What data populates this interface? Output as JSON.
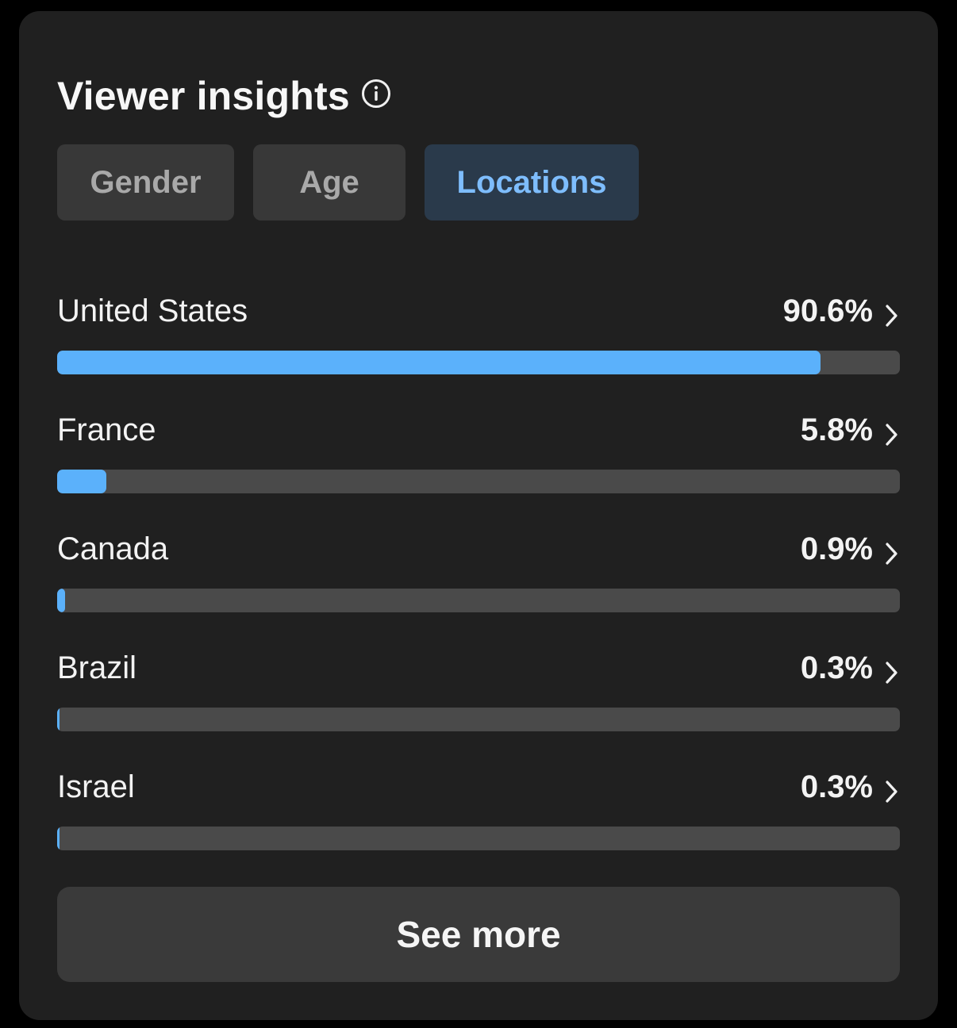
{
  "header": {
    "title": "Viewer insights",
    "info_icon": "info-circle-icon"
  },
  "tabs": [
    {
      "label": "Gender",
      "active": false
    },
    {
      "label": "Age",
      "active": false
    },
    {
      "label": "Locations",
      "active": true
    }
  ],
  "locations": [
    {
      "name": "United States",
      "value": "90.6%",
      "fraction": 0.906
    },
    {
      "name": "France",
      "value": "5.8%",
      "fraction": 0.058
    },
    {
      "name": "Canada",
      "value": "0.9%",
      "fraction": 0.009
    },
    {
      "name": "Brazil",
      "value": "0.3%",
      "fraction": 0.003
    },
    {
      "name": "Israel",
      "value": "0.3%",
      "fraction": 0.003
    }
  ],
  "see_more": {
    "label": "See more"
  },
  "colors": {
    "card_bg": "#202020",
    "accent": "#5bb1fb",
    "active_tab_bg": "#2a3a4b",
    "active_tab_text": "#7ebdfd",
    "track": "#4a4a4a"
  }
}
